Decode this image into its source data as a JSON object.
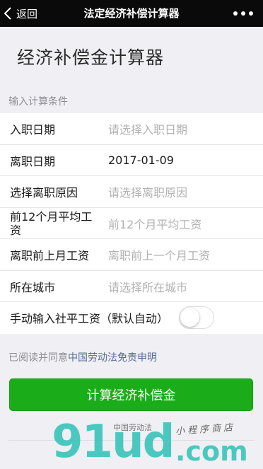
{
  "nav": {
    "back_label": "返回",
    "title": "法定经济补偿计算器"
  },
  "page_title": "经济补偿金计算器",
  "section_label": "输入计算条件",
  "form": {
    "hire_date": {
      "label": "入职日期",
      "placeholder": "请选择入职日期"
    },
    "leave_date": {
      "label": "离职日期",
      "value": "2017-01-09"
    },
    "leave_reason": {
      "label": "选择离职原因",
      "placeholder": "请选择离职原因"
    },
    "avg_salary": {
      "label": "前12个月平均工资",
      "placeholder": "前12个月平均工资"
    },
    "last_salary": {
      "label": "离职前上月工资",
      "placeholder": "离职前上一个月工资"
    },
    "city": {
      "label": "所在城市",
      "placeholder": "请选择所在城市"
    },
    "manual_avg": {
      "label": "手动输入社平工资（默认自动）",
      "toggle_on": false
    }
  },
  "agreement": {
    "prefix": "已阅读并同意",
    "link": "中国劳动法免责申明"
  },
  "calc_button": "计算经济补偿金",
  "watermark": {
    "big": "91ud",
    "com": ".com",
    "small": "中国劳动法",
    "script": "小程序商店"
  },
  "colors": {
    "nav_bg": "#0a0a0a",
    "primary_green": "#1aad19",
    "link_blue": "#576b95",
    "placeholder": "#b2b2b2",
    "page_bg": "#efeff4"
  }
}
